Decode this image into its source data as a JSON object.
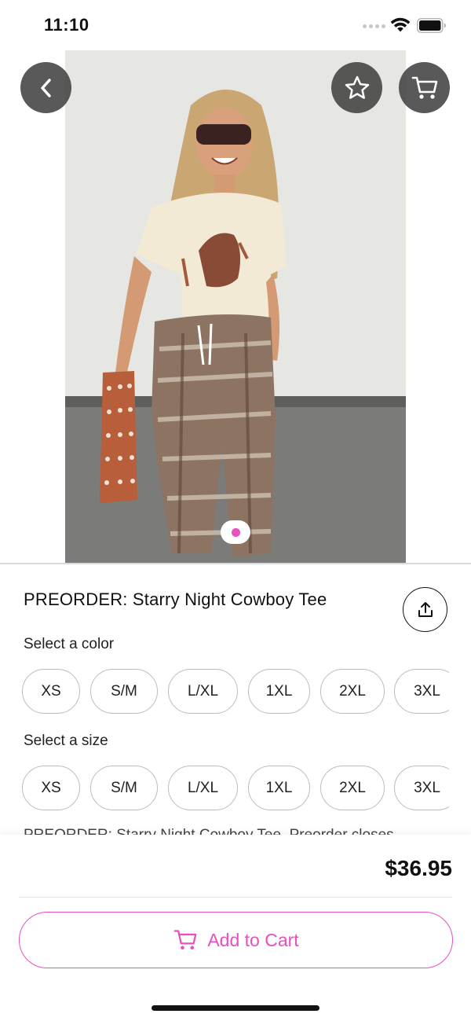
{
  "status_bar": {
    "time": "11:10"
  },
  "product": {
    "title": "PREORDER: Starry Night Cowboy Tee",
    "description_preview": "PREORDER: Starry Night Cowboy Tee. Preorder closes",
    "price": "$36.95",
    "image_count": 1,
    "active_image_index": 1
  },
  "color_section": {
    "label": "Select a color",
    "options": [
      "XS",
      "S/M",
      "L/XL",
      "1XL",
      "2XL",
      "3XL"
    ]
  },
  "size_section": {
    "label": "Select a size",
    "options": [
      "XS",
      "S/M",
      "L/XL",
      "1XL",
      "2XL",
      "3XL"
    ]
  },
  "actions": {
    "add_to_cart_label": "Add to Cart"
  },
  "icons": {
    "back": "chevron-left-icon",
    "favorite": "star-outline-icon",
    "cart": "cart-icon",
    "share": "share-icon"
  },
  "colors": {
    "accent": "#e84fbf",
    "chip_border": "#bdbdbd",
    "overlay_button": "#3c3c3c"
  }
}
